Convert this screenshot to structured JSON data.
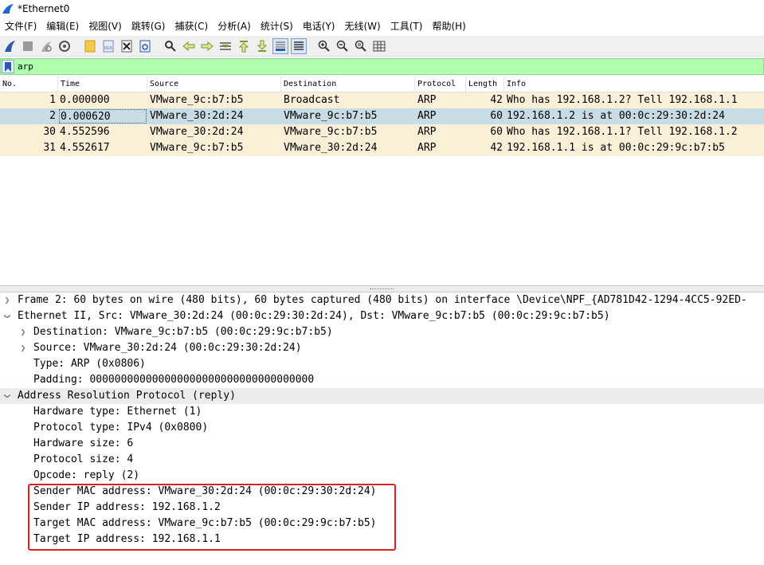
{
  "window": {
    "title": "*Ethernet0"
  },
  "menu": [
    "文件(F)",
    "编辑(E)",
    "视图(V)",
    "跳转(G)",
    "捕获(C)",
    "分析(A)",
    "统计(S)",
    "电话(Y)",
    "无线(W)",
    "工具(T)",
    "帮助(H)"
  ],
  "toolbar": {
    "icons": [
      "start-capture-icon",
      "stop-capture-icon",
      "restart-capture-icon",
      "capture-options-icon",
      "open-file-icon",
      "save-file-icon",
      "close-file-icon",
      "reload-file-icon",
      "find-packet-icon",
      "go-back-icon",
      "go-forward-icon",
      "go-to-packet-icon",
      "go-first-icon",
      "go-last-icon",
      "auto-scroll-icon",
      "colorize-icon",
      "zoom-in-icon",
      "zoom-out-icon",
      "normal-size-icon",
      "resize-columns-icon"
    ]
  },
  "filter": {
    "value": "arp"
  },
  "packet_list": {
    "columns": [
      "No.",
      "Time",
      "Source",
      "Destination",
      "Protocol",
      "Length",
      "Info"
    ],
    "rows": [
      {
        "no": "1",
        "time": "0.000000",
        "source": "VMware_9c:b7:b5",
        "destination": "Broadcast",
        "protocol": "ARP",
        "length": "42",
        "info": "Who has 192.168.1.2? Tell 192.168.1.1"
      },
      {
        "no": "2",
        "time": "0.000620",
        "source": "VMware_30:2d:24",
        "destination": "VMware_9c:b7:b5",
        "protocol": "ARP",
        "length": "60",
        "info": "192.168.1.2 is at 00:0c:29:30:2d:24"
      },
      {
        "no": "30",
        "time": "4.552596",
        "source": "VMware_30:2d:24",
        "destination": "VMware_9c:b7:b5",
        "protocol": "ARP",
        "length": "60",
        "info": "Who has 192.168.1.1? Tell 192.168.1.2"
      },
      {
        "no": "31",
        "time": "4.552617",
        "source": "VMware_9c:b7:b5",
        "destination": "VMware_30:2d:24",
        "protocol": "ARP",
        "length": "42",
        "info": "192.168.1.1 is at 00:0c:29:9c:b7:b5"
      }
    ],
    "selected_row": 1
  },
  "details": {
    "frame": "Frame 2: 60 bytes on wire (480 bits), 60 bytes captured (480 bits) on interface \\Device\\NPF_{AD781D42-1294-4CC5-92ED-",
    "ethernet": "Ethernet II, Src: VMware_30:2d:24 (00:0c:29:30:2d:24), Dst: VMware_9c:b7:b5 (00:0c:29:9c:b7:b5)",
    "eth_dst": "Destination: VMware_9c:b7:b5 (00:0c:29:9c:b7:b5)",
    "eth_src": "Source: VMware_30:2d:24 (00:0c:29:30:2d:24)",
    "eth_type": "Type: ARP (0x0806)",
    "eth_padding": "Padding: 000000000000000000000000000000000000",
    "arp": "Address Resolution Protocol (reply)",
    "hw_type": "Hardware type: Ethernet (1)",
    "proto_type": "Protocol type: IPv4 (0x0800)",
    "hw_size": "Hardware size: 6",
    "proto_size": "Protocol size: 4",
    "opcode": "Opcode: reply (2)",
    "sender_mac": "Sender MAC address: VMware_30:2d:24 (00:0c:29:30:2d:24)",
    "sender_ip": "Sender IP address: 192.168.1.2",
    "target_mac": "Target MAC address: VMware_9c:b7:b5 (00:0c:29:9c:b7:b5)",
    "target_ip": "Target IP address: 192.168.1.1"
  },
  "colors": {
    "arp_row_bg": "#faf0d7",
    "selected_row_bg": "#c8dce6",
    "filter_bg": "#afffaf",
    "annotation_box": "#e02020",
    "toolbar_icon_blue": "#2a5aa8"
  }
}
